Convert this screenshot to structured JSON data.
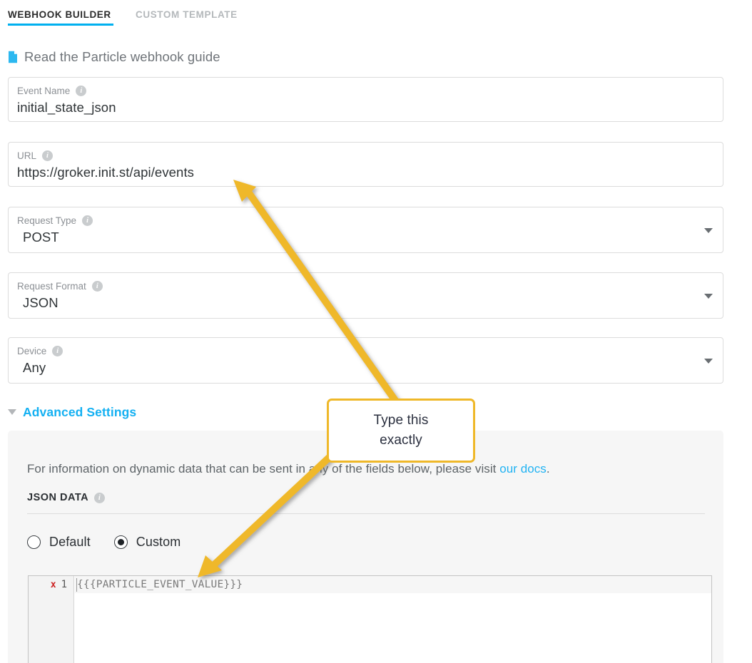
{
  "tabs": [
    {
      "label": "WEBHOOK BUILDER",
      "active": true
    },
    {
      "label": "CUSTOM TEMPLATE",
      "active": false
    }
  ],
  "guide": {
    "icon": "document-icon",
    "text": "Read the Particle webhook guide"
  },
  "fields": {
    "event_name": {
      "label": "Event Name",
      "value": "initial_state_json",
      "info_icon": "info-icon"
    },
    "url": {
      "label": "URL",
      "value": "https://groker.init.st/api/events",
      "info_icon": "info-icon"
    },
    "request_type": {
      "label": "Request Type",
      "value": "POST",
      "info_icon": "info-icon",
      "caret_icon": "chevron-down-icon"
    },
    "request_format": {
      "label": "Request Format",
      "value": "JSON",
      "info_icon": "info-icon",
      "caret_icon": "chevron-down-icon"
    },
    "device": {
      "label": "Device",
      "value": "Any",
      "info_icon": "info-icon",
      "caret_icon": "chevron-down-icon"
    }
  },
  "advanced": {
    "title": "Advanced Settings",
    "toggle_icon": "triangle-down-icon",
    "intro_prefix": "For information on dynamic data that can be sent in any of the fields below, please visit ",
    "intro_link": "our docs",
    "intro_suffix": ".",
    "json_data_label": "JSON DATA",
    "json_data_info_icon": "info-icon",
    "radios": [
      {
        "label": "Default",
        "checked": false
      },
      {
        "label": "Custom",
        "checked": true
      }
    ],
    "editor": {
      "error_marker": "x",
      "line_number": "1",
      "code": "{{{PARTICLE_EVENT_VALUE}}}"
    }
  },
  "annotations": {
    "callout_line1": "Type this",
    "callout_line2": "exactly"
  },
  "colors": {
    "accent_blue": "#00b0ef",
    "link_blue": "#21b3f3",
    "annotation_yellow": "#efb829",
    "error_red": "#cc2222",
    "panel_grey": "#f6f6f6"
  }
}
